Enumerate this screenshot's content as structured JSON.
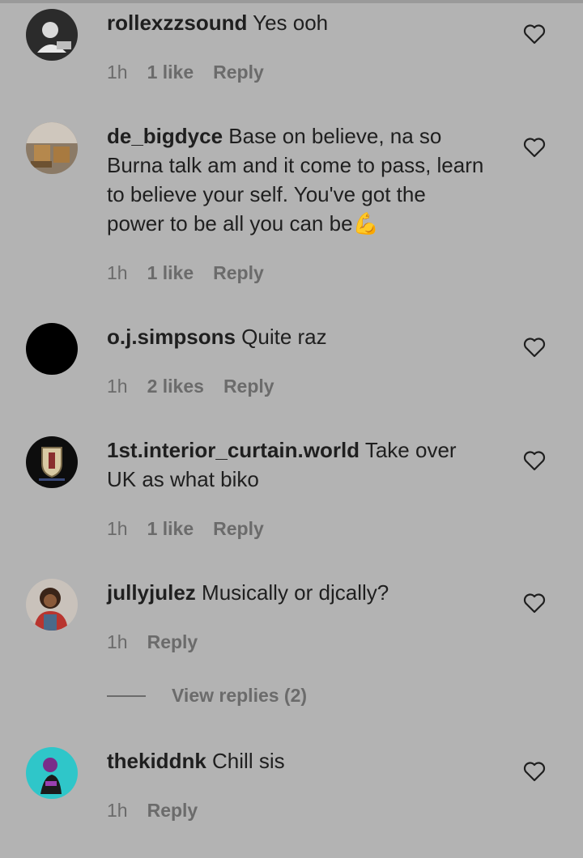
{
  "comments": [
    {
      "username": "rollexzzsound",
      "text": "Yes ooh",
      "time": "1h",
      "likes": "1 like",
      "reply": "Reply"
    },
    {
      "username": "de_bigdyce",
      "text": "Base on believe, na so Burna talk am and it come to pass, learn to believe your self. You've got the power to be all you can be💪",
      "time": "1h",
      "likes": "1 like",
      "reply": "Reply"
    },
    {
      "username": "o.j.simpsons",
      "text": "Quite raz",
      "time": "1h",
      "likes": "2 likes",
      "reply": "Reply"
    },
    {
      "username": "1st.interior_curtain.world",
      "text": "Take over UK as what biko",
      "time": "1h",
      "likes": "1 like",
      "reply": "Reply"
    },
    {
      "username": "jullyjulez",
      "text": "Musically or djcally?",
      "time": "1h",
      "likes": "",
      "reply": "Reply"
    },
    {
      "username": "thekiddnk",
      "text": "Chill sis",
      "time": "1h",
      "likes": "",
      "reply": "Reply"
    }
  ],
  "view_replies_label": "View replies (2)",
  "icons": {
    "like": "heart-outline-icon"
  }
}
